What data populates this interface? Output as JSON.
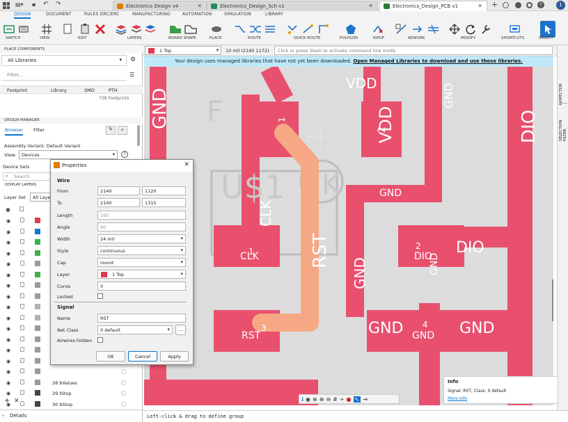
{
  "titlebar": {
    "tabs": [
      {
        "label": "Electronics Design v4",
        "icon_color": "#e57a00",
        "active": false
      },
      {
        "label": "Electronics_Design_Sch v1",
        "icon_color": "#1d8f5a",
        "active": false
      },
      {
        "label": "Electronics_Design_PCB v1",
        "icon_color": "#2b7a35",
        "active": true
      }
    ],
    "user_badge": "1"
  },
  "ribbon": {
    "tabs": [
      "DESIGN",
      "DOCUMENT",
      "RULES DRC/ERC",
      "MANUFACTURING",
      "AUTOMATION",
      "SIMULATION",
      "LIBRARY"
    ],
    "groups": [
      "SWITCH",
      "VIEW",
      "EDIT",
      "LAYERS",
      "BOARD SHAPE",
      "PLACE",
      "ROUTE",
      "QUICK ROUTE",
      "POLYGON",
      "RIPUP",
      "REWORK",
      "MODIFY",
      "SHORTCUTS",
      "SELECT"
    ]
  },
  "left": {
    "place_components": "PLACE COMPONENTS",
    "library_select": "All Libraries",
    "filter_placeholder": "Filter...",
    "table_headers": [
      "Footprint",
      "Library",
      "SMD",
      "PTH"
    ],
    "footprint_count": "738 Footprints",
    "design_manager": "DESIGN MANAGER",
    "tabs": [
      "Browser",
      "Filter"
    ],
    "assembly_variant": "Assembly Variant:  Default Variant",
    "view_label": "View:",
    "view_value": "Devices",
    "device_sets": "Device Sets",
    "search_placeholder": "Search",
    "display_layers": "DISPLAY LAYERS",
    "layer_set_label": "Layer Set",
    "layer_set_value": "All Layers",
    "layers": [
      {
        "name": "",
        "color": "#e23b52"
      },
      {
        "name": "",
        "color": "#1e73c8"
      },
      {
        "name": "",
        "color": "#3cb04a"
      },
      {
        "name": "",
        "color": "#3cb04a"
      },
      {
        "name": "",
        "color": "#9a9a9a"
      },
      {
        "name": "",
        "color": "#3cb04a"
      },
      {
        "name": "",
        "color": "#9a9a9a"
      },
      {
        "name": "",
        "color": "#9a9a9a"
      },
      {
        "name": "",
        "color": "#b0b0b0"
      },
      {
        "name": "",
        "color": "#b0b0b0"
      },
      {
        "name": "",
        "color": "#9a9a9a"
      },
      {
        "name": "",
        "color": "#9a9a9a"
      },
      {
        "name": "",
        "color": "#9a9a9a"
      },
      {
        "name": "",
        "color": "#9a9a9a"
      },
      {
        "name": "",
        "color": "#9a9a9a"
      },
      {
        "name": "28 bValues",
        "color": "#9a9a9a"
      },
      {
        "name": "29 tStop",
        "color": "#444444"
      },
      {
        "name": "30 bStop",
        "color": "#444444"
      }
    ],
    "details": "Details"
  },
  "cmdbar": {
    "layer": "1 Top",
    "layer_color": "#e23b52",
    "coords": "10 mil (2140 1172)",
    "command_placeholder": "Click or press Slash to activate command line mode"
  },
  "banner": {
    "text": "Your design uses managed libraries that have not yet been downloaded.",
    "link": "Open Managed Libraries to download and use these libraries."
  },
  "canvas": {
    "labels": [
      "GND",
      "VDD",
      "VDD",
      "GND",
      "DIO",
      "1",
      "2",
      "GND",
      "CLK",
      "RST",
      "1",
      "2",
      "CLK",
      "DIO",
      "DIO",
      "GND",
      "GND",
      "3",
      "4",
      "RST",
      "GND",
      "GND",
      "GND",
      "U$1",
      "K",
      "F"
    ],
    "trace_label": "RST"
  },
  "dialog": {
    "title": "Properties",
    "wire_section": "Wire",
    "from_label": "From",
    "from_x": "2140",
    "from_y": "1120",
    "to_label": "To",
    "to_x": "2140",
    "to_y": "1315",
    "length_label": "Length",
    "length": "195",
    "angle_label": "Angle",
    "angle": "90",
    "width_label": "Width",
    "width": "24 mil",
    "style_label": "Style",
    "style": "continuous",
    "cap_label": "Cap",
    "cap": "round",
    "layer_label": "Layer",
    "layer": "1 Top",
    "curve_label": "Curve",
    "curve": "0",
    "locked_label": "Locked",
    "signal_section": "Signal",
    "name_label": "Name",
    "name": "RST",
    "netclass_label": "Net Class",
    "netclass": "0 default",
    "airwires_label": "Airwires hidden",
    "ok": "OK",
    "cancel": "Cancel",
    "apply": "Apply"
  },
  "info": {
    "title": "Info",
    "text": "Signal: RST, Class: 0 default",
    "link": "More Info"
  },
  "right_strip": {
    "inspector": "INSPECTOR",
    "selection_filter": "SELECTION FILTER"
  },
  "status": {
    "text": "Left-click & drag to define group"
  }
}
